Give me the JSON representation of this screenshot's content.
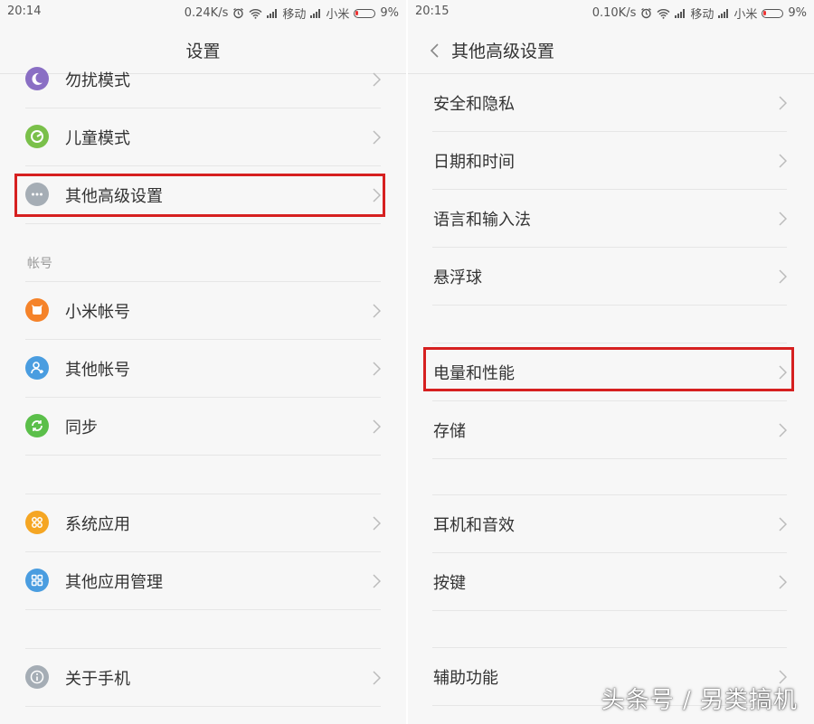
{
  "left": {
    "status": {
      "time": "20:14",
      "speed": "0.24K/s",
      "carrier1": "移动",
      "carrier2": "小米",
      "battery": "9%"
    },
    "title": "设置",
    "items": [
      {
        "label": "勿扰模式",
        "icon": "moon-icon",
        "color": "#8a6fc4"
      },
      {
        "label": "儿童模式",
        "icon": "child-mode-icon",
        "color": "#7ac04a"
      },
      {
        "label": "其他高级设置",
        "icon": "more-dots-icon",
        "color": "#a5adb5"
      }
    ],
    "section_label": "帐号",
    "account_items": [
      {
        "label": "小米帐号",
        "icon": "mi-account-icon",
        "color": "#f5832a"
      },
      {
        "label": "其他帐号",
        "icon": "person-icon",
        "color": "#4a9de0"
      },
      {
        "label": "同步",
        "icon": "sync-icon",
        "color": "#5bbf4a"
      }
    ],
    "app_items": [
      {
        "label": "系统应用",
        "icon": "system-apps-icon",
        "color": "#f5a623"
      },
      {
        "label": "其他应用管理",
        "icon": "app-grid-icon",
        "color": "#4a9de0"
      }
    ],
    "about_item": {
      "label": "关于手机",
      "icon": "info-icon",
      "color": "#a5adb5"
    }
  },
  "right": {
    "status": {
      "time": "20:15",
      "speed": "0.10K/s",
      "carrier1": "移动",
      "carrier2": "小米",
      "battery": "9%"
    },
    "title": "其他高级设置",
    "group1": [
      "安全和隐私",
      "日期和时间",
      "语言和输入法",
      "悬浮球"
    ],
    "group2": [
      "电量和性能",
      "存储"
    ],
    "group3": [
      "耳机和音效",
      "按键"
    ],
    "group4": [
      "辅助功能"
    ]
  },
  "watermark": "头条号 / 另类搞机",
  "colors": {
    "highlight": "#d62020",
    "background": "#f7f7f7"
  }
}
